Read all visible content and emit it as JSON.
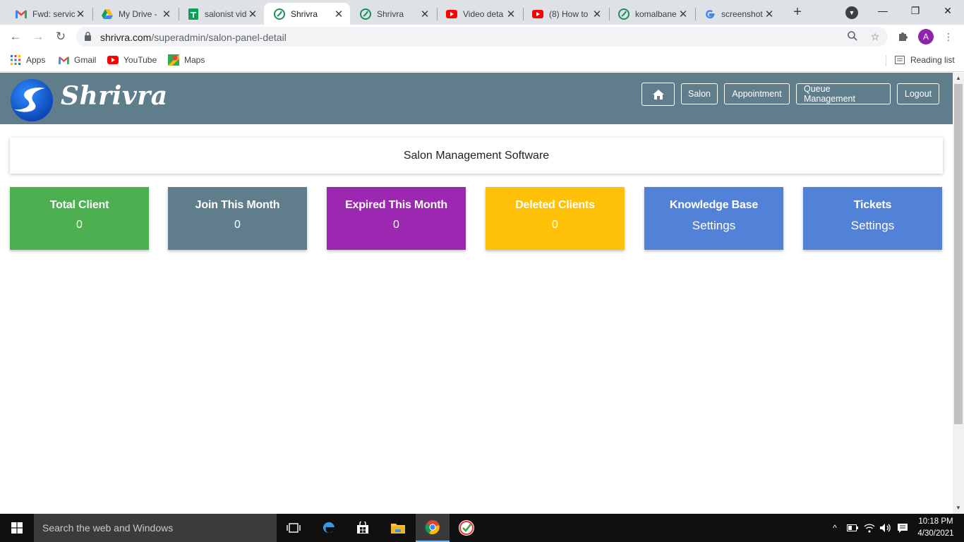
{
  "browser": {
    "tabs": [
      {
        "title": "Fwd: servic",
        "icon": "gmail-icon",
        "active": false
      },
      {
        "title": "My Drive -",
        "icon": "google-drive-icon",
        "active": false
      },
      {
        "title": "salonist vid",
        "icon": "google-sheets-icon",
        "active": false
      },
      {
        "title": "Shrivra",
        "icon": "shrivra-favicon-icon",
        "active": true
      },
      {
        "title": "Shrivra",
        "icon": "shrivra-favicon-icon",
        "active": false
      },
      {
        "title": "Video deta",
        "icon": "youtube-icon",
        "active": false
      },
      {
        "title": "(8) How to",
        "icon": "youtube-icon",
        "active": false
      },
      {
        "title": "komalbane",
        "icon": "shrivra-favicon-icon",
        "active": false
      },
      {
        "title": "screenshot",
        "icon": "google-icon",
        "active": false
      }
    ],
    "url_domain": "shrivra.com",
    "url_path": "/superadmin/salon-panel-detail",
    "profile_initial": "A",
    "bookmarks": [
      "Apps",
      "Gmail",
      "YouTube",
      "Maps"
    ],
    "reading_list": "Reading list"
  },
  "site": {
    "logo_text": "Shrivra",
    "nav": {
      "salon": "Salon",
      "appointment": "Appointment",
      "queue": "Queue Management",
      "logout": "Logout"
    },
    "banner_title": "Salon Management Software",
    "cards": [
      {
        "title": "Total Client",
        "value": "0",
        "color": "#4caf50"
      },
      {
        "title": "Join This Month",
        "value": "0",
        "color": "#607d8b"
      },
      {
        "title": "Expired This Month",
        "value": "0",
        "color": "#9c27b0"
      },
      {
        "title": "Deleted Clients",
        "value": "0",
        "color": "#ffc107"
      },
      {
        "title": "Knowledge Base",
        "value": "Settings",
        "color": "#5282d8"
      },
      {
        "title": "Tickets",
        "value": "Settings",
        "color": "#5282d8"
      }
    ],
    "header_color": "#5f7d8a"
  },
  "taskbar": {
    "search_placeholder": "Search the web and Windows",
    "time": "10:18 PM",
    "date": "4/30/2021"
  }
}
